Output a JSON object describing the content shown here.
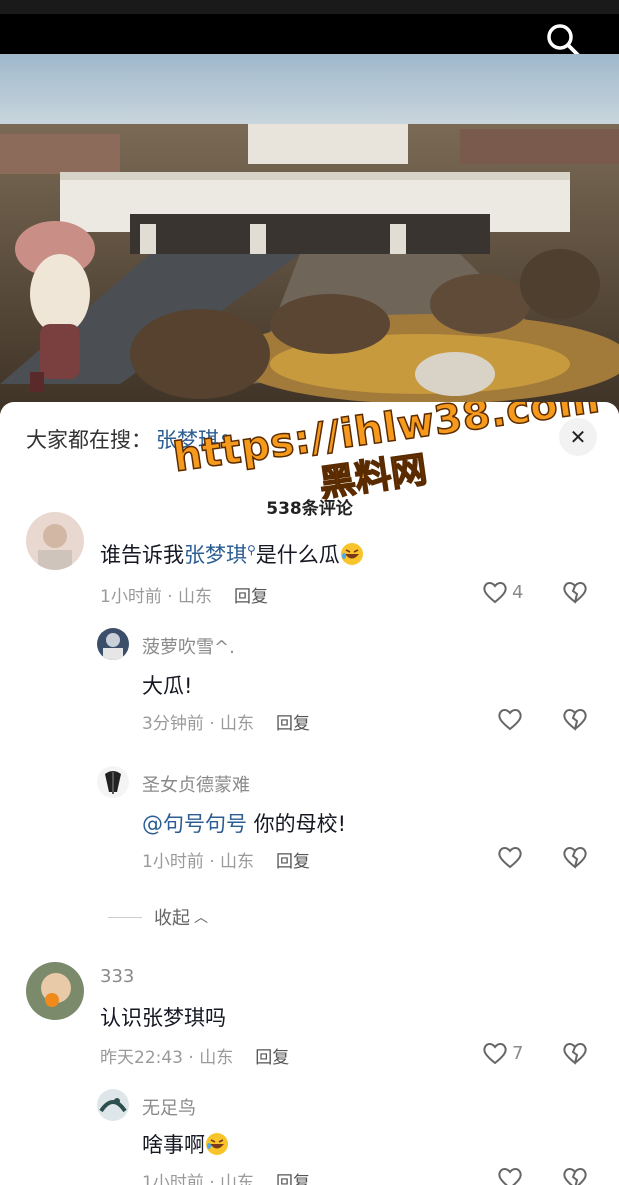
{
  "search_hint": {
    "label": "大家都在搜：",
    "term": "张梦琪"
  },
  "watermark": {
    "url": "https://ihlw38.com",
    "text": "黑料网"
  },
  "comment_count": "538条评论",
  "collapse_label": "收起",
  "comments": [
    {
      "name": "",
      "text_link": "张梦琪",
      "text_prefix": "谁告诉我",
      "text_suffix": "是什么瓜",
      "meta": "1小时前 · 山东",
      "reply": "回复",
      "likes": "4"
    },
    {
      "name": "菠萝吹雪^.",
      "text": "大瓜!",
      "meta": "3分钟前 · 山东",
      "reply": "回复",
      "likes": ""
    },
    {
      "name": "圣女贞德蒙难",
      "mention": "@句号句号",
      "text": " 你的母校!",
      "meta": "1小时前 · 山东",
      "reply": "回复",
      "likes": ""
    },
    {
      "name": "333",
      "text": "认识张梦琪吗",
      "meta": "昨天22:43 · 山东",
      "reply": "回复",
      "likes": "7"
    },
    {
      "name": "无足鸟",
      "text": "啥事啊",
      "meta": "1小时前 · 山东",
      "reply": "回复",
      "likes": ""
    }
  ],
  "colors": {
    "link": "#2c5e93",
    "watermark": "#f59a1c"
  },
  "icons": [
    "search-icon",
    "close-icon",
    "heart-icon",
    "broken-heart-icon",
    "laughing-emoji"
  ]
}
